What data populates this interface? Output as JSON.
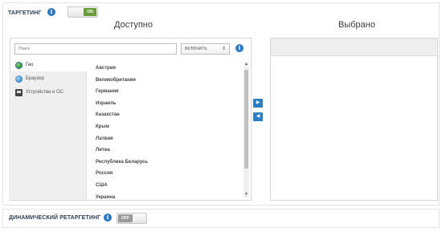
{
  "targeting": {
    "title": "ТАРГЕТИНГ",
    "toggle_state": "ON",
    "available_heading": "Доступно",
    "selected_heading": "Выбрано",
    "search_placeholder": "Поиск",
    "mode_select_value": "ВКЛЮЧИТЬ",
    "tabs": [
      {
        "label": "Гео",
        "icon": "globe-icon"
      },
      {
        "label": "Браузер",
        "icon": "browser-icon"
      },
      {
        "label": "Устройства и ОС",
        "icon": "device-icon"
      }
    ],
    "items": [
      "Австрия",
      "Великобритания",
      "Германия",
      "Израиль",
      "Казахстан",
      "Крым",
      "Латвия",
      "Литва",
      "Республика Беларусь",
      "Россия",
      "США",
      "Украина"
    ],
    "add_arrow": "▶",
    "remove_arrow": "◀"
  },
  "retargeting": {
    "title": "ДИНАМИЧЕСКИЙ РЕТАРГЕТИНГ",
    "toggle_state": "OFF"
  },
  "info_glyph": "i",
  "colors": {
    "accent_blue": "#2d7fc5",
    "toggle_on": "#6a9c3a",
    "toggle_off": "#9a9a9a"
  }
}
